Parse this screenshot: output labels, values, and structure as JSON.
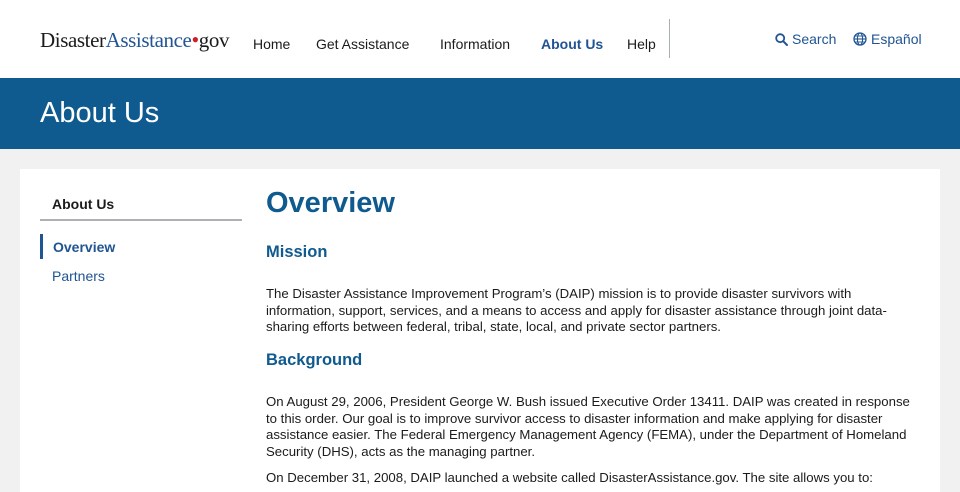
{
  "header": {
    "logo": {
      "part1": "Disaster",
      "part2": "Assistance",
      "dot": "•",
      "part3": "gov"
    },
    "nav": {
      "home": "Home",
      "get_assistance": "Get Assistance",
      "information": "Information",
      "about_us": "About Us",
      "help": "Help"
    },
    "search_label": "Search",
    "language_label": "Español"
  },
  "banner": {
    "title": "About Us"
  },
  "sidebar": {
    "heading": "About Us",
    "items": [
      {
        "label": "Overview",
        "current": true
      },
      {
        "label": "Partners",
        "current": false
      }
    ]
  },
  "main": {
    "title": "Overview",
    "mission": {
      "heading": "Mission",
      "text": "The Disaster Assistance Improvement Program’s (DAIP) mission is to provide disaster survivors with information, support, services, and a means to access and apply for disaster assistance through joint data-sharing efforts between federal, tribal, state, local, and private sector partners."
    },
    "background": {
      "heading": "Background",
      "text1": "On August 29, 2006, President George W. Bush issued Executive Order 13411. DAIP was created in response to this order. Our goal is to improve survivor access to disaster information and make applying for disaster assistance easier. The Federal Emergency Management Agency (FEMA), under the Department of Homeland Security (DHS), acts as the managing partner.",
      "text2": "On December 31, 2008, DAIP launched a website called DisasterAssistance.gov. The site allows you to:"
    }
  },
  "colors": {
    "brand_blue": "#0f5a8e",
    "link_blue": "#205493",
    "logo_dot_red": "#cd2026"
  },
  "icons": {
    "search": "search-icon",
    "language": "globe-icon"
  }
}
